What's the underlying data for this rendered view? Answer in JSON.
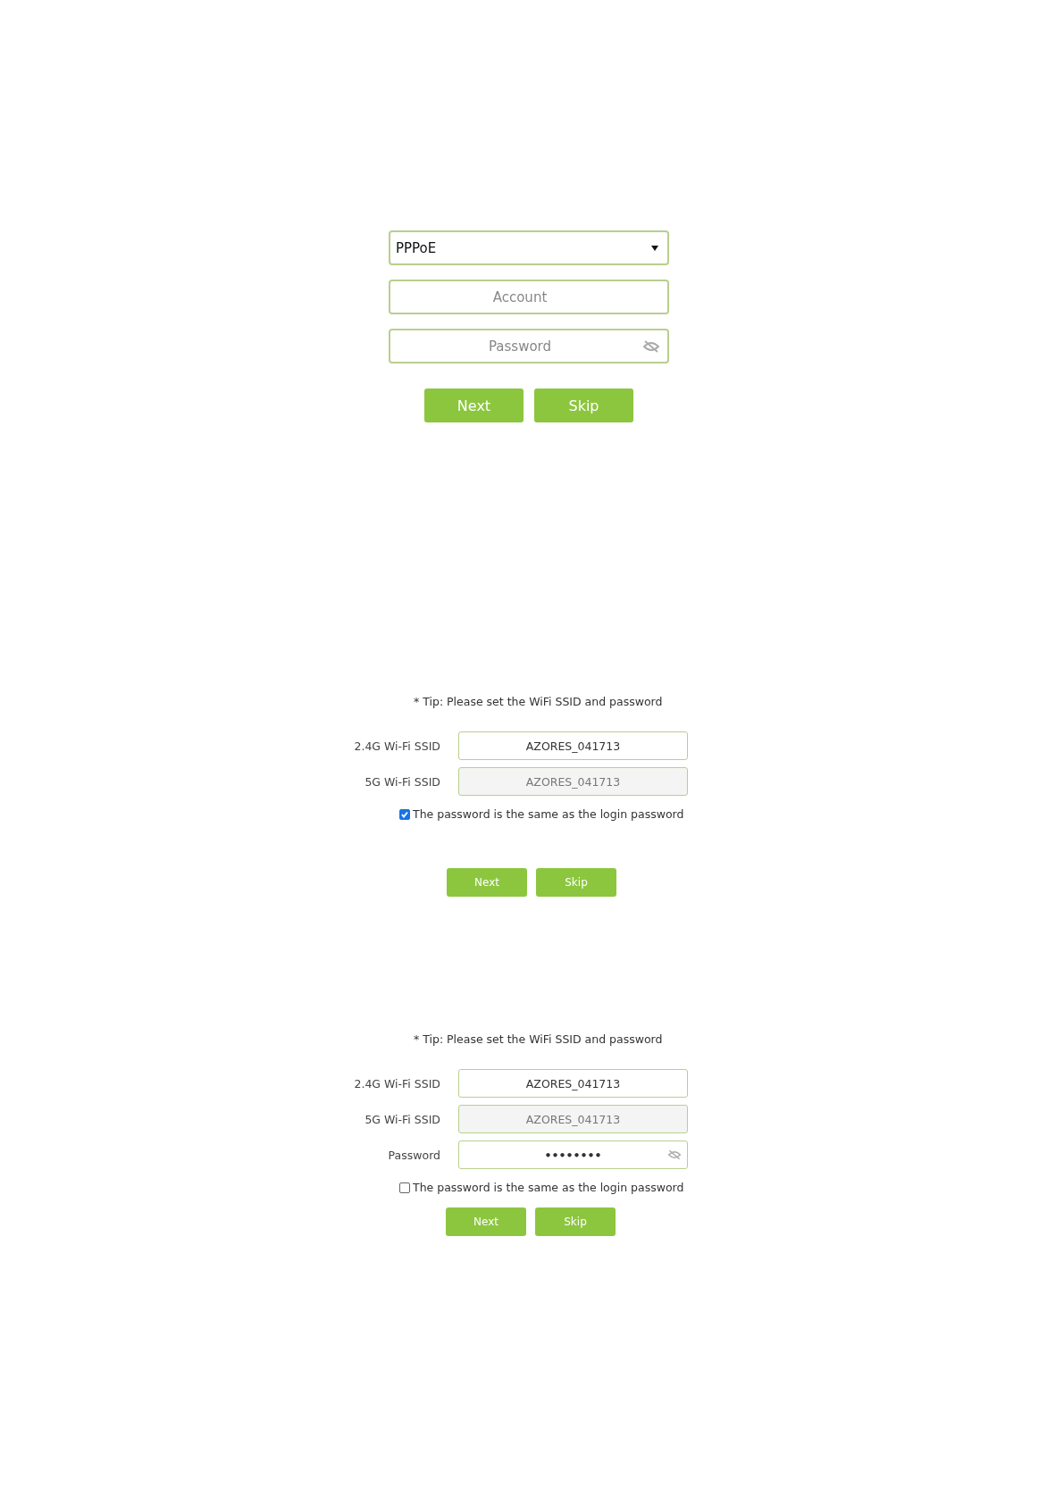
{
  "pppoe_form": {
    "connection_type": "PPPoE",
    "fields": [
      {
        "kind": "text",
        "placeholder": "Account"
      },
      {
        "kind": "password",
        "placeholder": "Password"
      }
    ],
    "buttons": [
      "Next",
      "Skip"
    ]
  },
  "wifi_forms": [
    {
      "tip": "* Tip: Please set the WiFi SSID and password",
      "fields": [
        {
          "kind": "text",
          "label": "2.4G Wi-Fi SSID",
          "value": "AZORES_041713",
          "disabled": false
        },
        {
          "kind": "text",
          "label": "5G Wi-Fi SSID",
          "value": "AZORES_041713",
          "disabled": true
        }
      ],
      "same_password": {
        "label": "The password is the same as the login password",
        "checked": true
      },
      "buttons": [
        "Next",
        "Skip"
      ]
    },
    {
      "tip": "* Tip: Please set the WiFi SSID and password",
      "fields": [
        {
          "kind": "text",
          "label": "2.4G Wi-Fi SSID",
          "value": "AZORES_041713",
          "disabled": false
        },
        {
          "kind": "text",
          "label": "5G Wi-Fi SSID",
          "value": "AZORES_041713",
          "disabled": true
        },
        {
          "kind": "password",
          "label": "Password",
          "value": "••••••••",
          "disabled": false
        }
      ],
      "same_password": {
        "label": "The password is the same as the login password",
        "checked": false
      },
      "buttons": [
        "Next",
        "Skip"
      ]
    }
  ]
}
